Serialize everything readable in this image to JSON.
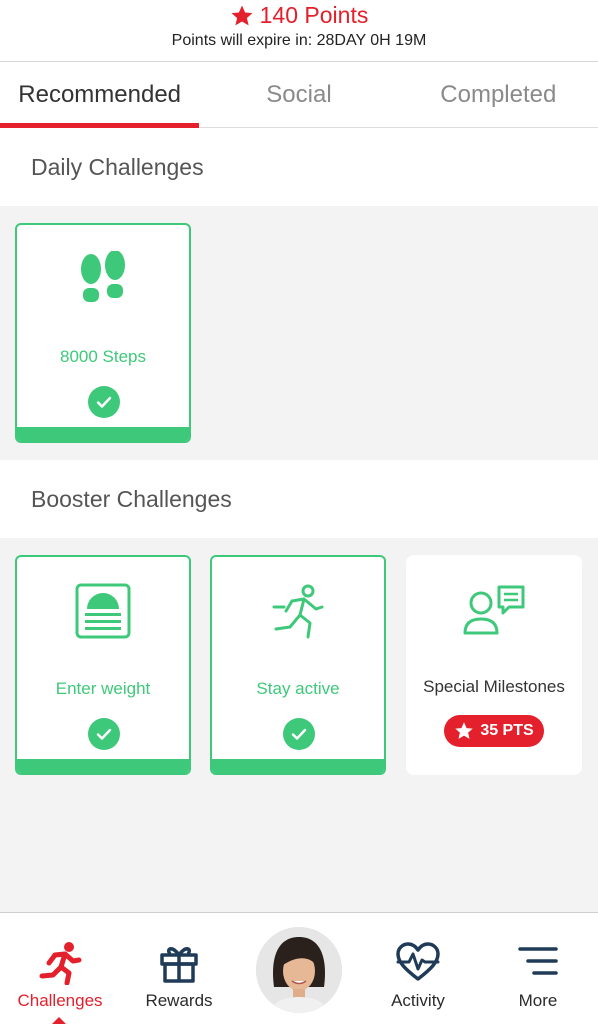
{
  "header": {
    "points_label": "140 Points",
    "expire_text": "Points will expire in: 28DAY 0H 19M",
    "star_icon": "star-icon",
    "accent_color": "#e3202b"
  },
  "tabs": [
    {
      "label": "Recommended",
      "active": true
    },
    {
      "label": "Social",
      "active": false
    },
    {
      "label": "Completed",
      "active": false
    }
  ],
  "daily": {
    "title": "Daily Challenges",
    "cards": [
      {
        "label": "8000 Steps",
        "icon": "footprints-icon",
        "completed": true
      }
    ]
  },
  "booster": {
    "title": "Booster Challenges",
    "cards": [
      {
        "label": "Enter weight",
        "icon": "weight-scale-icon",
        "completed": true
      },
      {
        "label": "Stay active",
        "icon": "running-person-icon",
        "completed": true
      },
      {
        "label": "Special Milestones",
        "icon": "person-chat-icon",
        "completed": false,
        "badge": "35 PTS"
      }
    ]
  },
  "colors": {
    "success": "#3ec97a",
    "accent": "#e3202b"
  },
  "nav": {
    "items": [
      {
        "label": "Challenges",
        "icon": "running-icon",
        "active": true
      },
      {
        "label": "Rewards",
        "icon": "gift-icon",
        "active": false
      },
      {
        "label": "",
        "icon": "avatar",
        "active": false
      },
      {
        "label": "Activity",
        "icon": "heartbeat-icon",
        "active": false
      },
      {
        "label": "More",
        "icon": "menu-icon",
        "active": false
      }
    ]
  }
}
